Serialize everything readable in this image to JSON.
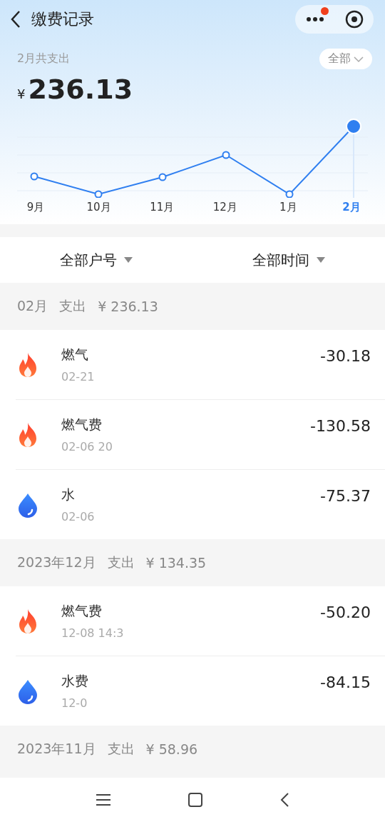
{
  "header": {
    "title": "缴费记录"
  },
  "summary": {
    "label": "2月共支出",
    "currency": "¥",
    "amount": "236.13",
    "filter": "全部"
  },
  "chart": {
    "months": [
      {
        "label": "9月",
        "selected": false
      },
      {
        "label": "10月",
        "selected": false
      },
      {
        "label": "11月",
        "selected": false
      },
      {
        "label": "12月",
        "selected": false
      },
      {
        "label": "1月",
        "selected": false
      },
      {
        "label": "2月",
        "selected": true
      }
    ]
  },
  "filters": [
    {
      "label": "全部户号"
    },
    {
      "label": "全部时间"
    }
  ],
  "groups": [
    {
      "month": "02月",
      "label": "支出",
      "total": "¥ 236.13",
      "items": [
        {
          "kind": "gas",
          "title": "燃气",
          "subtitle": "02-21",
          "amount": "-30.18"
        },
        {
          "kind": "gas",
          "title": "燃气费",
          "subtitle": "02-06 20",
          "amount": "-130.58"
        },
        {
          "kind": "water",
          "title": "水",
          "subtitle": "02-06",
          "amount": "-75.37"
        }
      ]
    },
    {
      "month": "2023年12月",
      "label": "支出",
      "total": "¥ 134.35",
      "items": [
        {
          "kind": "gas",
          "title": "燃气费",
          "subtitle": "12-08 14:3",
          "amount": "-50.20"
        },
        {
          "kind": "water",
          "title": "水费",
          "subtitle": "12-0",
          "amount": "-84.15"
        }
      ]
    },
    {
      "month": "2023年11月",
      "label": "支出",
      "total": "¥ 58.96"
    }
  ]
}
